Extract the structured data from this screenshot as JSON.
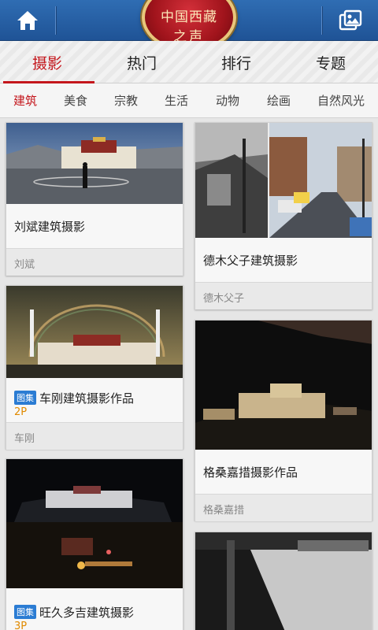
{
  "header": {
    "logo_line1": "中国西藏",
    "logo_line2": "之声",
    "home_icon": "home-icon",
    "gallery_icon": "gallery-icon"
  },
  "main_tabs": [
    {
      "label": "摄影",
      "active": true
    },
    {
      "label": "热门",
      "active": false
    },
    {
      "label": "排行",
      "active": false
    },
    {
      "label": "专题",
      "active": false
    }
  ],
  "sub_tabs": [
    {
      "label": "建筑",
      "active": true
    },
    {
      "label": "美食",
      "active": false
    },
    {
      "label": "宗教",
      "active": false
    },
    {
      "label": "生活",
      "active": false
    },
    {
      "label": "动物",
      "active": false
    },
    {
      "label": "绘画",
      "active": false
    },
    {
      "label": "自然风光",
      "active": false
    }
  ],
  "cards": [
    {
      "title": "刘斌建筑摄影",
      "author": "刘斌"
    },
    {
      "title": "德木父子建筑摄影",
      "author": "德木父子"
    },
    {
      "badge": "图集",
      "title": "车刚建筑摄影作品",
      "pages": "2P",
      "author": "车刚"
    },
    {
      "title": "格桑嘉措摄影作品",
      "author": "格桑嘉措"
    },
    {
      "badge": "图集",
      "title": "旺久多吉建筑摄影",
      "pages": "3P"
    }
  ]
}
